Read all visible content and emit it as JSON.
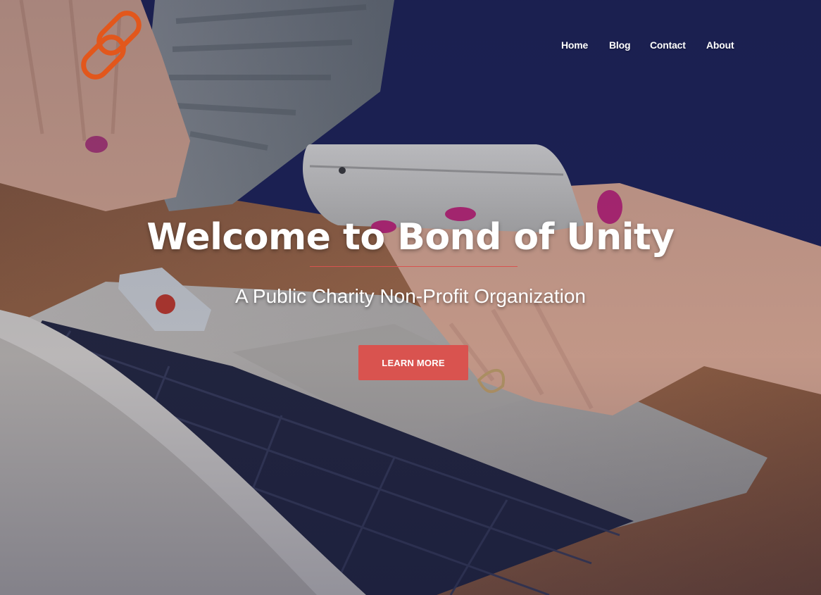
{
  "brand": {
    "logo_icon": "chain-link-icon",
    "logo_color": "#e2571c"
  },
  "nav": {
    "items": [
      {
        "label": "Home"
      },
      {
        "label": "Blog"
      },
      {
        "label": "Contact"
      },
      {
        "label": "About"
      }
    ]
  },
  "hero": {
    "headline": "Welcome to Bond of Unity",
    "subtitle": "A Public Charity Non-Profit Organization",
    "cta_label": "LEARN MORE",
    "background": "photo-hands-phone-laptop",
    "accent_color": "#d9534f"
  }
}
